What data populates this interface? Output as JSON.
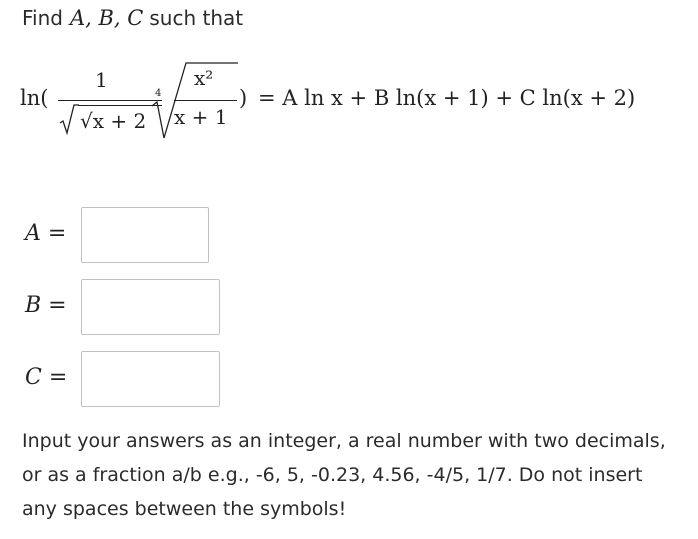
{
  "heading": {
    "prefix": "Find",
    "vars": "A, B, C",
    "suffix": "such that"
  },
  "equation": {
    "ln_open": "ln(",
    "frac_num": "1",
    "frac_den": "√x + 2",
    "root_index": "4",
    "inner_num": "x²",
    "inner_den": "x + 1",
    "close_paren": ")",
    "rhs": "= A ln x + B ln(x + 1) + C ln(x + 2)"
  },
  "answers": [
    {
      "label": "A =",
      "value": ""
    },
    {
      "label": "B =",
      "value": ""
    },
    {
      "label": "C =",
      "value": ""
    }
  ],
  "instructions": "Input your answers as an integer, a real number with two decimals, or as a fraction a/b  e.g., -6, 5, -0.23, 4.56, -4/5, 1/7. Do not insert any spaces between the symbols!"
}
